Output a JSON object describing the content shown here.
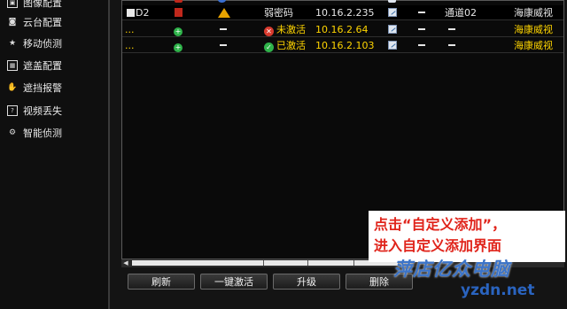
{
  "sidebar": {
    "items": [
      {
        "label": "图像配置",
        "icon": "image-icon"
      },
      {
        "label": "云台配置",
        "icon": "ptz-icon"
      },
      {
        "label": "移动侦测",
        "icon": "motion-icon"
      },
      {
        "label": "遮盖配置",
        "icon": "mask-icon"
      },
      {
        "label": "遮挡报警",
        "icon": "hand-icon"
      },
      {
        "label": "视频丢失",
        "icon": "video-loss-icon"
      },
      {
        "label": "智能侦测",
        "icon": "smart-detect-icon"
      }
    ]
  },
  "devices": [
    {
      "channel": "D2",
      "status": "弱密码",
      "ip": "10.16.2.235",
      "col_a": "",
      "port_label": "通道02",
      "brand": "海康威视",
      "style": "white"
    },
    {
      "channel": "...",
      "status": "未激活",
      "ip": "10.16.2.64",
      "col_a": "",
      "port_label": "",
      "brand": "海康威视",
      "style": "yellow"
    },
    {
      "channel": "...",
      "status": "已激活",
      "ip": "10.16.2.103",
      "col_a": "",
      "port_label": "",
      "brand": "海康威视",
      "style": "yellow"
    }
  ],
  "buttons": {
    "refresh": "刷新",
    "activate_all": "一键激活",
    "upgrade": "升级",
    "delete": "删除"
  },
  "annotation": {
    "line1": "点击“自定义添加”，",
    "line2": "进入自定义添加界面"
  },
  "watermark": {
    "text": "萍店亿众电脑",
    "site": "yzdn.net"
  },
  "colors": {
    "accent_yellow": "#ffd500",
    "annotation_red": "#e0241b",
    "active_green": "#2fb34a",
    "warning_orange": "#e8a400"
  }
}
